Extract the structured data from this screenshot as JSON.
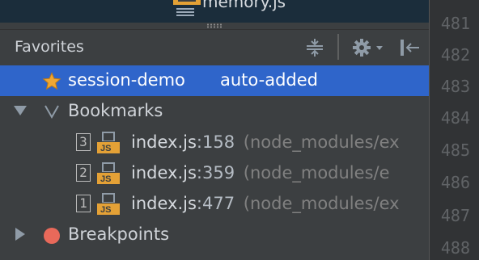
{
  "top_tab": {
    "text": "memory.js"
  },
  "panel": {
    "title": "Favorites",
    "toolbar": {
      "collapse_icon": "collapse-all-icon",
      "settings_icon": "gear-icon",
      "hide_icon": "hide-panel-icon"
    }
  },
  "tree": {
    "session": {
      "name": "session-demo",
      "suffix": "auto-added",
      "icon": "star-icon"
    },
    "bookmarks": {
      "label": "Bookmarks",
      "items": [
        {
          "mnemonic": "3",
          "file": "index.js",
          "line": ":158",
          "path": "(node_modules/ex"
        },
        {
          "mnemonic": "2",
          "file": "index.js",
          "line": ":359",
          "path": "(node_modules/e"
        },
        {
          "mnemonic": "1",
          "file": "index.js",
          "line": ":477",
          "path": "(node_modules/ex"
        }
      ]
    },
    "breakpoints": {
      "label": "Breakpoints"
    }
  },
  "gutter": {
    "lines": [
      "481",
      "482",
      "483",
      "484",
      "485",
      "486",
      "487",
      "488"
    ]
  },
  "colors": {
    "selection": "#2f65ca",
    "panel_bg": "#3c3f41",
    "text": "#cfd3d8",
    "muted_text": "#808080",
    "js_badge": "#e4a136",
    "breakpoint": "#e8695a"
  }
}
